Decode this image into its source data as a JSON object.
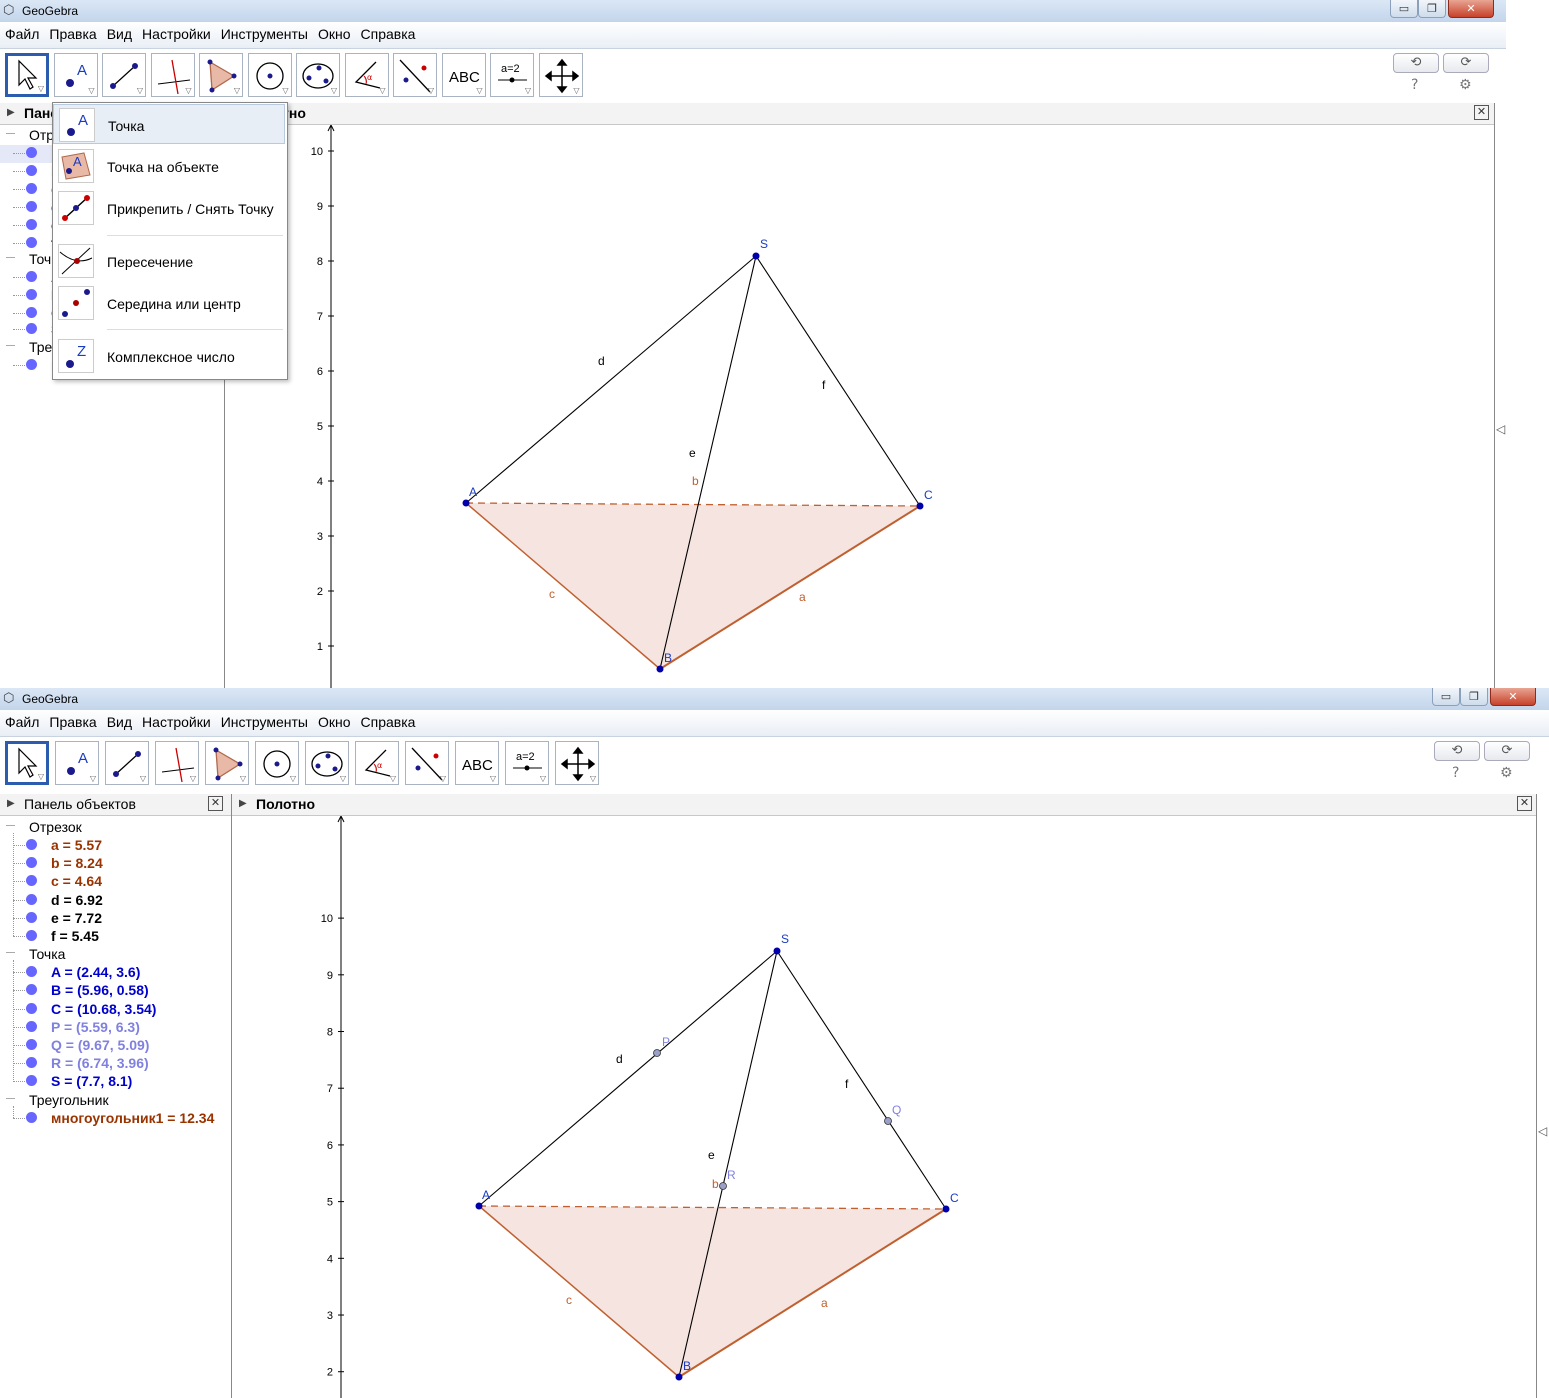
{
  "window1": {
    "title": "GeoGebra",
    "menu": [
      "Файл",
      "Правка",
      "Вид",
      "Настройки",
      "Инструменты",
      "Окно",
      "Справка"
    ],
    "left_panel_title_partial": "Пане",
    "graphics_title_partial": "тно",
    "tree_partial": {
      "groups": [
        "Отр",
        "Точ",
        "Тре"
      ],
      "cut_values": [
        "а",
        "b",
        "с",
        "d",
        "е",
        "f",
        "A",
        "B",
        "C",
        "S",
        "м"
      ]
    },
    "dropdown": {
      "items": [
        {
          "label": "Точка",
          "icon": "point-icon",
          "highlighted": true
        },
        {
          "label": "Точка на объекте",
          "icon": "point-on-object-icon"
        },
        {
          "label": "Прикрепить / Снять Точку",
          "icon": "attach-detach-point-icon"
        },
        {
          "label": "Пересечение",
          "icon": "intersect-icon"
        },
        {
          "label": "Середина или центр",
          "icon": "midpoint-icon"
        },
        {
          "label": "Комплексное число",
          "icon": "complex-number-icon"
        }
      ]
    },
    "y_ticks": [
      "10",
      "9",
      "8",
      "7",
      "6",
      "5",
      "4",
      "3",
      "2",
      "1"
    ],
    "labels": {
      "S": "S",
      "A": "A",
      "C": "C",
      "B": "B",
      "d": "d",
      "f": "f",
      "e": "e",
      "b": "b",
      "c": "c",
      "a": "a"
    }
  },
  "window2": {
    "title": "GeoGebra",
    "menu": [
      "Файл",
      "Правка",
      "Вид",
      "Настройки",
      "Инструменты",
      "Окно",
      "Справка"
    ],
    "left_panel_title": "Панель объектов",
    "graphics_title": "Полотно",
    "groups": [
      {
        "name": "Отрезок",
        "items": [
          {
            "text": "a = 5.57",
            "color": "#993300"
          },
          {
            "text": "b = 8.24",
            "color": "#993300"
          },
          {
            "text": "c = 4.64",
            "color": "#993300"
          },
          {
            "text": "d = 6.92",
            "color": "#000000"
          },
          {
            "text": "e = 7.72",
            "color": "#000000"
          },
          {
            "text": "f = 5.45",
            "color": "#000000"
          }
        ]
      },
      {
        "name": "Точка",
        "items": [
          {
            "text": "A = (2.44, 3.6)",
            "color": "#0000cc"
          },
          {
            "text": "B = (5.96, 0.58)",
            "color": "#0000cc"
          },
          {
            "text": "C = (10.68, 3.54)",
            "color": "#0000cc"
          },
          {
            "text": "P = (5.59, 6.3)",
            "color": "#8080e0"
          },
          {
            "text": "Q = (9.67, 5.09)",
            "color": "#8080e0"
          },
          {
            "text": "R = (6.74, 3.96)",
            "color": "#8080e0"
          },
          {
            "text": "S = (7.7, 8.1)",
            "color": "#0000cc"
          }
        ]
      },
      {
        "name": "Треугольник",
        "items": [
          {
            "text": "многоугольник1 = 12.34",
            "color": "#993300"
          }
        ]
      }
    ],
    "y_ticks": [
      "10",
      "9",
      "8",
      "7",
      "6",
      "5",
      "4",
      "3",
      "2",
      "1"
    ],
    "labels": {
      "S": "S",
      "A": "A",
      "C": "C",
      "B": "B",
      "P": "P",
      "Q": "Q",
      "R": "R",
      "d": "d",
      "f": "f",
      "e": "e",
      "b": "b",
      "c": "c",
      "a": "a"
    }
  },
  "toolbar": {
    "text_tool": "ABC",
    "slider_tool": "a=2",
    "help": "?",
    "undo": "⟲",
    "redo": "⟳",
    "settings": "⚙"
  },
  "colors": {
    "point": "#0000aa",
    "segment_brown": "#c06030",
    "fill": "#f5e4df",
    "selected_tool_border": "#2c5cad"
  }
}
